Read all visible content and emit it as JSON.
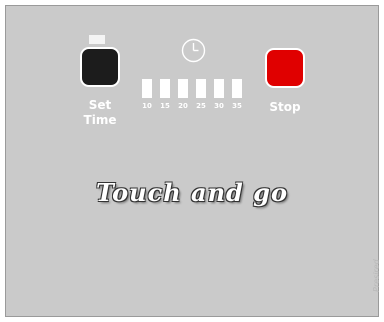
{
  "controls": {
    "set_time_label_line1": "Set",
    "set_time_label_line2": "Time",
    "stop_label": "Stop",
    "set_button_color": "#1c1c1c",
    "stop_button_color": "#e00000"
  },
  "timer": {
    "clock_icon": "clock-icon",
    "intervals": [
      "10",
      "15",
      "20",
      "25",
      "30",
      "35"
    ]
  },
  "tagline": "Touch and go",
  "watermark": "Presired"
}
